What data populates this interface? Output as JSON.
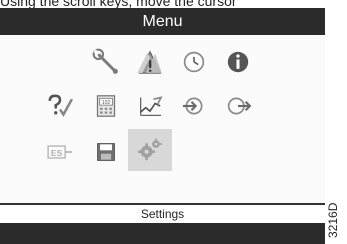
{
  "caption": "Using the scroll keys, move the cursor",
  "menu": {
    "title": "Menu"
  },
  "icons": [
    {
      "name": "wrench-icon"
    },
    {
      "name": "warning-triangle-icon"
    },
    {
      "name": "clock-icon"
    },
    {
      "name": "info-icon"
    },
    {
      "name": "help-check-icon"
    },
    {
      "name": "calculator-display-icon"
    },
    {
      "name": "trend-graph-icon"
    },
    {
      "name": "arrow-in-icon"
    },
    {
      "name": "arrow-out-icon"
    },
    {
      "name": "es-icon"
    },
    {
      "name": "save-disk-icon"
    },
    {
      "name": "settings-gears-icon"
    }
  ],
  "selected_item": "Settings",
  "status": {
    "label": "Settings"
  },
  "figure_code": "3216D",
  "colors": {
    "bar": "#2b2b2b",
    "selected_bg": "#d8d8d8",
    "icon": "#808080"
  }
}
